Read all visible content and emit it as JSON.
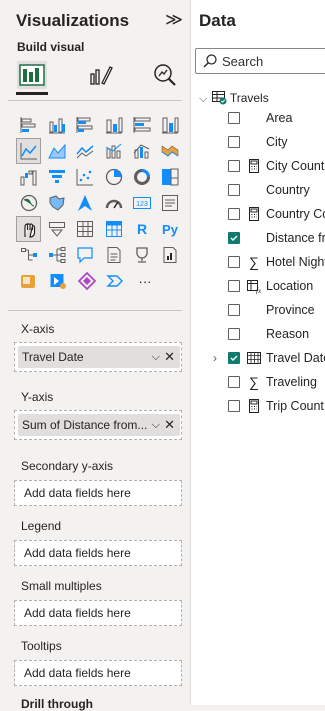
{
  "visualizations": {
    "title": "Visualizations",
    "collapse_glyph": "≫",
    "build_visual_label": "Build visual",
    "gallery_rows": [
      [
        "stacked-bar-chart-icon",
        "clustered-column-chart-icon",
        "clustered-bar-chart-icon",
        "stacked-column-chart-icon",
        "100-stacked-bar-chart-icon",
        "100-stacked-column-chart-icon"
      ],
      [
        "line-chart-icon",
        "area-chart-icon",
        "stacked-area-chart-icon",
        "line-stacked-column-chart-icon",
        "line-clustered-column-chart-icon",
        "ribbon-chart-icon"
      ],
      [
        "waterfall-chart-icon",
        "funnel-chart-icon",
        "scatter-chart-icon",
        "pie-chart-icon",
        "donut-chart-icon",
        "treemap-icon"
      ],
      [
        "map-icon",
        "filled-map-icon",
        "azure-map-icon",
        "gauge-icon",
        "card-icon",
        "multi-row-card-icon"
      ],
      [
        "kpi-icon",
        "slicer-icon",
        "table-icon",
        "matrix-icon",
        "r-script-visual-icon",
        "python-visual-icon"
      ],
      [
        "key-influencers-icon",
        "decomposition-tree-icon",
        "qna-icon",
        "smart-narrative-icon",
        "metrics-icon",
        "paginated-report-icon"
      ],
      [
        "power-apps-icon",
        "power-automate-icon",
        "custom-visual-icon",
        "chevron-visual-icon",
        "more-visuals-icon"
      ]
    ],
    "r_label": "R",
    "py_label": "Py",
    "more_label": "···",
    "card_label": "123",
    "wells": {
      "x_axis": {
        "label": "X-axis",
        "field": "Travel Date"
      },
      "y_axis": {
        "label": "Y-axis",
        "field": "Sum of Distance from..."
      },
      "secondary_y": {
        "label": "Secondary y-axis",
        "placeholder": "Add data fields here"
      },
      "legend": {
        "label": "Legend",
        "placeholder": "Add data fields here"
      },
      "small_multiples": {
        "label": "Small multiples",
        "placeholder": "Add data fields here"
      },
      "tooltips": {
        "label": "Tooltips",
        "placeholder": "Add data fields here"
      },
      "drill_through": {
        "label": "Drill through"
      }
    },
    "pill_chevron": "⌵",
    "pill_remove": "✕"
  },
  "data": {
    "title": "Data",
    "search_placeholder": "Search",
    "table_expander": "⌵",
    "table_name": "Travels",
    "fields": [
      {
        "name": "Area",
        "checked": false,
        "icon": ""
      },
      {
        "name": "City",
        "checked": false,
        "icon": ""
      },
      {
        "name": "City Count",
        "checked": false,
        "icon": "calculator"
      },
      {
        "name": "Country",
        "checked": false,
        "icon": ""
      },
      {
        "name": "Country Count",
        "checked": false,
        "icon": "calculator"
      },
      {
        "name": "Distance from Home",
        "checked": true,
        "icon": ""
      },
      {
        "name": "Hotel Nights",
        "checked": false,
        "icon": "sigma"
      },
      {
        "name": "Location",
        "checked": false,
        "icon": "table-fx"
      },
      {
        "name": "Province",
        "checked": false,
        "icon": ""
      },
      {
        "name": "Reason",
        "checked": false,
        "icon": ""
      },
      {
        "name": "Travel Date",
        "checked": true,
        "icon": "calendar",
        "expandable": true
      },
      {
        "name": "Traveling",
        "checked": false,
        "icon": "sigma"
      },
      {
        "name": "Trip Count",
        "checked": false,
        "icon": "calculator"
      }
    ],
    "expand_glyph": "›",
    "sigma_glyph": "∑"
  },
  "colors": {
    "accent": "#0f7b6c",
    "pane_bg": "#f3f2f1",
    "chart_blue": "#118dff"
  }
}
